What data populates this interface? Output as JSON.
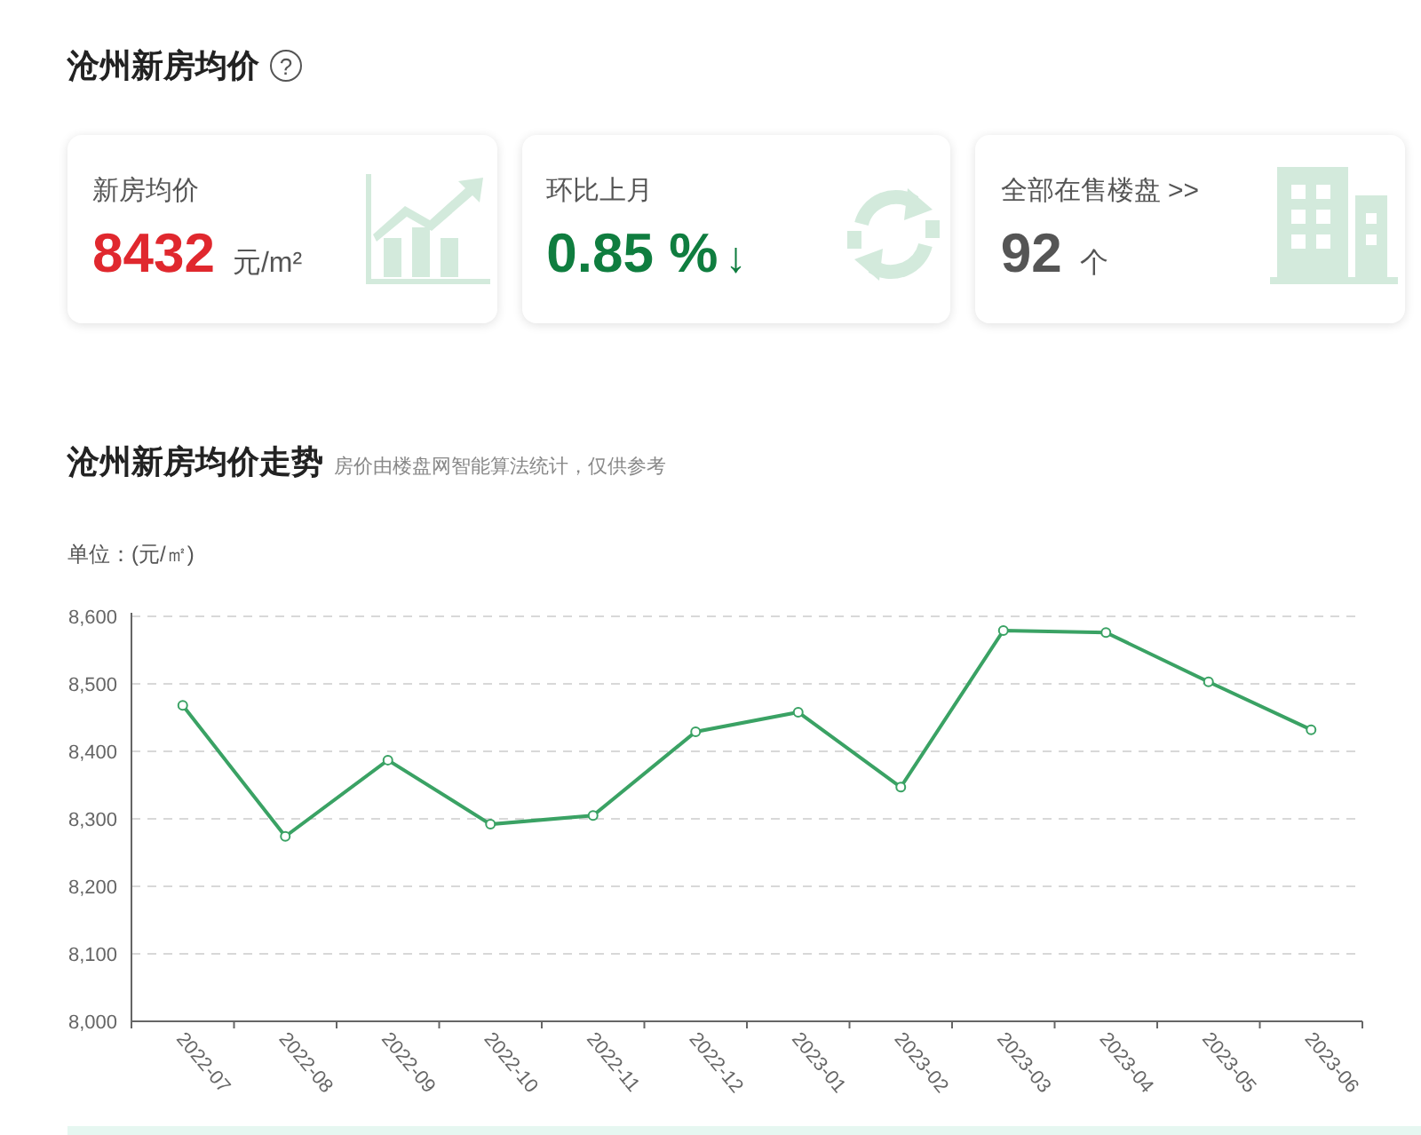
{
  "header": {
    "title": "沧州新房均价",
    "help_icon": "?"
  },
  "cards": [
    {
      "kind": "growth",
      "label": "新房均价",
      "value": "8432",
      "unit": "元/m²",
      "color": "#e0282e"
    },
    {
      "kind": "cycle",
      "label": "环比上月",
      "value": "0.85 %",
      "unit": "↓",
      "color": "#0f7d3f"
    },
    {
      "kind": "building",
      "label": "全部在售楼盘 >>",
      "value": "92",
      "unit": "个",
      "color": "#555555"
    }
  ],
  "trend": {
    "title": "沧州新房均价走势",
    "note": "房价由楼盘网智能算法统计，仅供参考",
    "unit_label": "单位：(元/㎡)",
    "chart_data": {
      "type": "line",
      "categories": [
        "2022-07",
        "2022-08",
        "2022-09",
        "2022-10",
        "2022-11",
        "2022-12",
        "2023-01",
        "2023-02",
        "2023-03",
        "2023-04",
        "2023-05",
        "2023-06"
      ],
      "grid": true,
      "series": [
        {
          "color": "#3aa264",
          "marker": true,
          "values": [
            8468,
            8274,
            8387,
            8292,
            8305,
            8429,
            8458,
            8347,
            8579,
            8576,
            8503,
            8432
          ]
        }
      ],
      "ylim": [
        8000,
        8600
      ],
      "yticks": [
        {
          "value": 8000,
          "label": "8,000"
        },
        {
          "value": 8100,
          "label": "8,100"
        },
        {
          "value": 8200,
          "label": "8,200"
        },
        {
          "value": 8300,
          "label": "8,300"
        },
        {
          "value": 8400,
          "label": "8,400"
        },
        {
          "value": 8500,
          "label": "8,500"
        },
        {
          "value": 8600,
          "label": "8,600"
        }
      ]
    }
  }
}
